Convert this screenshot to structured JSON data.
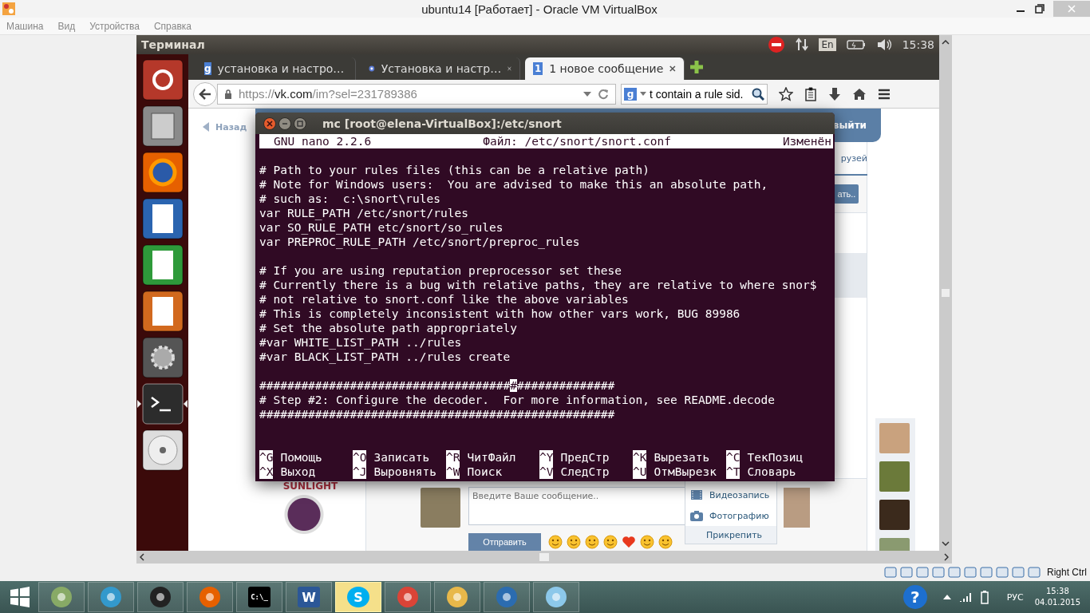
{
  "host_window": {
    "title": "ubuntu14 [Работает] - Oracle VM VirtualBox",
    "menu": [
      "Машина",
      "Вид",
      "Устройства",
      "Справка"
    ]
  },
  "ubuntu_panel": {
    "title": "Терминал",
    "keyboard": "En",
    "time": "15:38"
  },
  "launcher": [
    {
      "kind": "ubuntu",
      "active": false
    },
    {
      "kind": "files",
      "active": false
    },
    {
      "kind": "browser",
      "active": false
    },
    {
      "kind": "writer",
      "active": false
    },
    {
      "kind": "calc",
      "active": false
    },
    {
      "kind": "impress",
      "active": false
    },
    {
      "kind": "settings",
      "active": false
    },
    {
      "kind": "terminal",
      "active": true
    },
    {
      "kind": "disc",
      "active": false
    }
  ],
  "browser": {
    "tabs": [
      {
        "favicon": "g",
        "title": "установка и настро…",
        "selected": false
      },
      {
        "title": "Установка и настр…",
        "selected": false
      },
      {
        "favicon": "1",
        "title": "1 новое сообщение",
        "selected": true
      }
    ],
    "url": {
      "scheme": "https://",
      "host": "vk.com",
      "path": "/im?sel=231789386"
    },
    "search": {
      "engine": "g",
      "value": "t contain a rule sid."
    }
  },
  "vk": {
    "back": "Назад",
    "logout": "выйти",
    "friends_tab": "рузей",
    "action_button": "ать..",
    "ad_brand": "SUNLIGHT",
    "message_placeholder": "Введите Ваше сообщение..",
    "send": "Отправить",
    "emojis": [
      {
        "kind": "smile"
      },
      {
        "kind": "grin"
      },
      {
        "kind": "kiss"
      },
      {
        "kind": "surprise"
      },
      {
        "kind": "heart"
      },
      {
        "kind": "laugh"
      },
      {
        "kind": "relieved"
      }
    ],
    "attach_menu": [
      {
        "kind": "video",
        "label": "Видеозапись"
      },
      {
        "kind": "photo",
        "label": "Фотографию"
      }
    ],
    "attach": "Прикрепить"
  },
  "terminal": {
    "title": "mc [root@elena-VirtualBox]:/etc/snort",
    "header": {
      "left": "GNU nano 2.2.6",
      "center": "Файл: /etc/snort/snort.conf",
      "right": "Изменён"
    },
    "blocks": [
      [
        "# Path to your rules files (this can be a relative path)",
        "# Note for Windows users:  You are advised to make this an absolute path,",
        "# such as:  c:\\snort\\rules",
        "var RULE_PATH /etc/snort/rules",
        "var SO_RULE_PATH etc/snort/so_rules",
        "var PREPROC_RULE_PATH /etc/snort/preproc_rules"
      ],
      [
        "# If you are using reputation preprocessor set these",
        "# Currently there is a bug with relative paths, they are relative to where snor$",
        "# not relative to snort.conf like the above variables",
        "# This is completely inconsistent with how other vars work, BUG 89986",
        "# Set the absolute path appropriately",
        "#var WHITE_LIST_PATH ../rules",
        "#var BLACK_LIST_PATH ../rules create"
      ],
      [
        {
          "before": "####################################",
          "cursor": "#",
          "after": "##############"
        },
        "# Step #2: Configure the decoder.  For more information, see README.decode",
        "###################################################"
      ]
    ],
    "shortcuts": [
      [
        {
          "key": "^G",
          "label": "Помощь"
        },
        {
          "key": "^O",
          "label": "Записать"
        },
        {
          "key": "^R",
          "label": "ЧитФайл"
        },
        {
          "key": "^Y",
          "label": "ПредСтр"
        },
        {
          "key": "^K",
          "label": "Вырезать"
        },
        {
          "key": "^C",
          "label": "ТекПозиц"
        }
      ],
      [
        {
          "key": "^X",
          "label": "Выход"
        },
        {
          "key": "^J",
          "label": "Выровнять"
        },
        {
          "key": "^W",
          "label": "Поиск"
        },
        {
          "key": "^V",
          "label": "СледСтр"
        },
        {
          "key": "^U",
          "label": "ОтмВырезк"
        },
        {
          "key": "^T",
          "label": "Словарь"
        }
      ]
    ]
  },
  "host_status": {
    "host_key": "Right Ctrl"
  },
  "taskbar": {
    "items": [
      {
        "kind": "paint",
        "selected": false
      },
      {
        "kind": "calculator",
        "selected": false
      },
      {
        "kind": "webcam",
        "selected": false
      },
      {
        "kind": "browser",
        "selected": false
      },
      {
        "kind": "console",
        "glyph": "C:\\_",
        "selected": false
      },
      {
        "kind": "word",
        "glyph": "W",
        "selected": false
      },
      {
        "kind": "skype",
        "glyph": "S",
        "selected": true
      },
      {
        "kind": "chrome",
        "selected": false
      },
      {
        "kind": "folder",
        "selected": false
      },
      {
        "kind": "virtualbox",
        "selected": false
      },
      {
        "kind": "eye",
        "selected": false
      }
    ],
    "help": "?",
    "language": "РУС",
    "time": "15:38",
    "date": "04.01.2015"
  }
}
